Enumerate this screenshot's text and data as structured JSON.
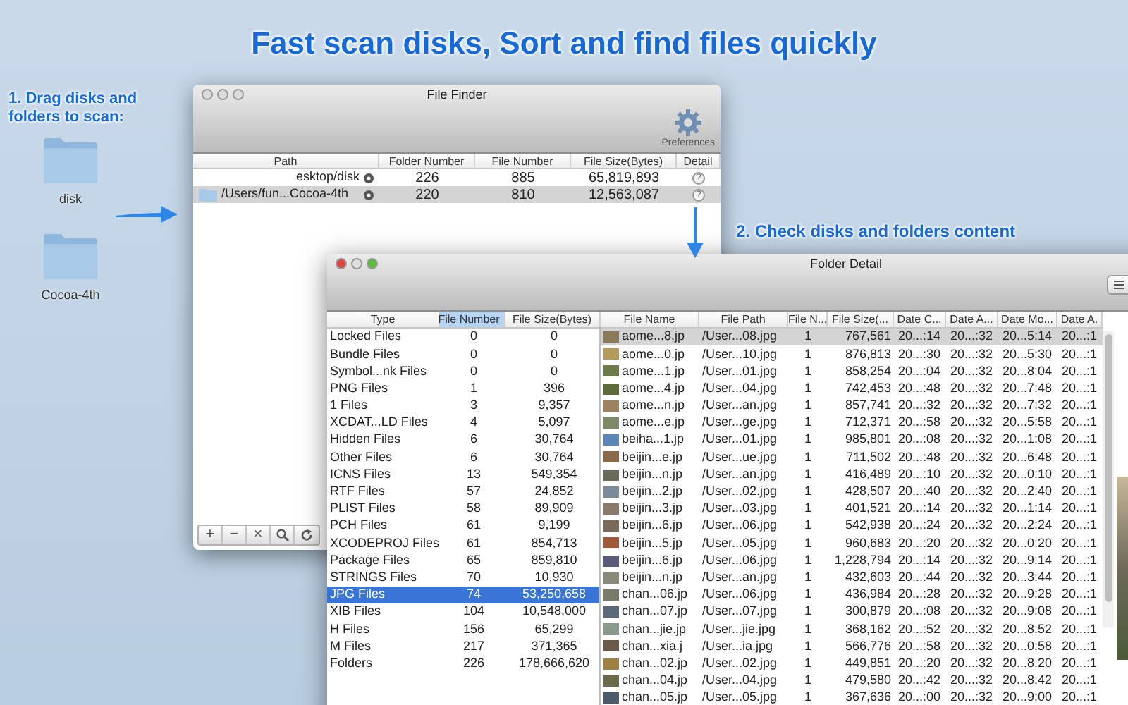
{
  "headline": "Fast scan disks, Sort and find files quickly",
  "desktop_items": [
    {
      "label": "disk"
    },
    {
      "label": "Cocoa-4th"
    }
  ],
  "annotations": [
    {
      "text": "1. Drag disks and folders to scan:"
    },
    {
      "text": "2. Check disks and folders content"
    }
  ],
  "file_finder": {
    "title": "File Finder",
    "toolbar_button": "Preferences",
    "columns": [
      "Path",
      "Folder Number",
      "File Number",
      "File Size(Bytes)",
      "Detail"
    ],
    "rows": [
      {
        "path": "esktop/disk",
        "icon": false,
        "folder_number": "226",
        "file_number": "885",
        "file_size": "65,819,893",
        "detail": "?",
        "selected": false
      },
      {
        "path": "/Users/fun...Cocoa-4th",
        "icon": true,
        "folder_number": "220",
        "file_number": "810",
        "file_size": "12,563,087",
        "detail": "?",
        "selected": true
      }
    ],
    "bottom_buttons": [
      {
        "kind": "text",
        "label": "+"
      },
      {
        "kind": "text",
        "label": "−"
      },
      {
        "kind": "text",
        "label": "×"
      },
      {
        "kind": "search"
      },
      {
        "kind": "refresh"
      }
    ]
  },
  "folder_detail": {
    "title": "Folder Detail",
    "type_table": {
      "columns": [
        {
          "label": "Type",
          "sorted": false
        },
        {
          "label": "File Number",
          "sorted": true
        },
        {
          "label": "File Size(Bytes)",
          "sorted": false
        }
      ],
      "rows": [
        {
          "cells": [
            "Locked Files",
            "0",
            "0"
          ],
          "selected": false
        },
        {
          "cells": [
            "Bundle Files",
            "0",
            "0"
          ],
          "selected": false
        },
        {
          "cells": [
            "Symbol...nk Files",
            "0",
            "0"
          ],
          "selected": false
        },
        {
          "cells": [
            "PNG Files",
            "1",
            "396"
          ],
          "selected": false
        },
        {
          "cells": [
            "1 Files",
            "3",
            "9,357"
          ],
          "selected": false
        },
        {
          "cells": [
            "XCDAT...LD Files",
            "4",
            "5,097"
          ],
          "selected": false
        },
        {
          "cells": [
            "Hidden Files",
            "6",
            "30,764"
          ],
          "selected": false
        },
        {
          "cells": [
            "Other Files",
            "6",
            "30,764"
          ],
          "selected": false
        },
        {
          "cells": [
            "ICNS Files",
            "13",
            "549,354"
          ],
          "selected": false
        },
        {
          "cells": [
            "RTF Files",
            "57",
            "24,852"
          ],
          "selected": false
        },
        {
          "cells": [
            "PLIST Files",
            "58",
            "89,909"
          ],
          "selected": false
        },
        {
          "cells": [
            "PCH Files",
            "61",
            "9,199"
          ],
          "selected": false
        },
        {
          "cells": [
            "XCODEPROJ Files",
            "61",
            "854,713"
          ],
          "selected": false
        },
        {
          "cells": [
            "Package Files",
            "65",
            "859,810"
          ],
          "selected": false
        },
        {
          "cells": [
            "STRINGS Files",
            "70",
            "10,930"
          ],
          "selected": false
        },
        {
          "cells": [
            "JPG Files",
            "74",
            "53,250,658"
          ],
          "selected": true
        },
        {
          "cells": [
            "XIB Files",
            "104",
            "10,548,000"
          ],
          "selected": false
        },
        {
          "cells": [
            "H Files",
            "156",
            "65,299"
          ],
          "selected": false
        },
        {
          "cells": [
            "M Files",
            "217",
            "371,365"
          ],
          "selected": false
        },
        {
          "cells": [
            "Folders",
            "226",
            "178,666,620"
          ],
          "selected": false
        }
      ]
    },
    "file_table": {
      "columns": [
        "File Name",
        "File Path",
        "File N...",
        "File Size(...",
        "Date C...",
        "Date A...",
        "Date Mo...",
        "Date A."
      ],
      "rows": [
        {
          "cells": [
            "aome...8.jp",
            "/User...08.jpg",
            "1",
            "767,561",
            "20...:14",
            "20...:32",
            "20...5:14",
            "20...:1"
          ],
          "selected": true
        },
        {
          "cells": [
            "aome...0.jp",
            "/User...10.jpg",
            "1",
            "876,813",
            "20...:30",
            "20...:32",
            "20...5:30",
            "20...:1"
          ],
          "selected": false
        },
        {
          "cells": [
            "aome...1.jp",
            "/User...01.jpg",
            "1",
            "858,254",
            "20...:04",
            "20...:32",
            "20...8:04",
            "20...:1"
          ],
          "selected": false
        },
        {
          "cells": [
            "aome...4.jp",
            "/User...04.jpg",
            "1",
            "742,453",
            "20...:48",
            "20...:32",
            "20...7:48",
            "20...:1"
          ],
          "selected": false
        },
        {
          "cells": [
            "aome...n.jp",
            "/User...an.jpg",
            "1",
            "857,741",
            "20...:32",
            "20...:32",
            "20...7:32",
            "20...:1"
          ],
          "selected": false
        },
        {
          "cells": [
            "aome...e.jp",
            "/User...ge.jpg",
            "1",
            "712,371",
            "20...:58",
            "20...:32",
            "20...5:58",
            "20...:1"
          ],
          "selected": false
        },
        {
          "cells": [
            "beiha...1.jp",
            "/User...01.jpg",
            "1",
            "985,801",
            "20...:08",
            "20...:32",
            "20...1:08",
            "20...:1"
          ],
          "selected": false
        },
        {
          "cells": [
            "beijin...e.jp",
            "/User...ue.jpg",
            "1",
            "711,502",
            "20...:48",
            "20...:32",
            "20...6:48",
            "20...:1"
          ],
          "selected": false
        },
        {
          "cells": [
            "beijin...n.jp",
            "/User...an.jpg",
            "1",
            "416,489",
            "20...:10",
            "20...:32",
            "20...0:10",
            "20...:1"
          ],
          "selected": false
        },
        {
          "cells": [
            "beijin...2.jp",
            "/User...02.jpg",
            "1",
            "428,507",
            "20...:40",
            "20...:32",
            "20...2:40",
            "20...:1"
          ],
          "selected": false
        },
        {
          "cells": [
            "beijin...3.jp",
            "/User...03.jpg",
            "1",
            "401,521",
            "20...:14",
            "20...:32",
            "20...1:14",
            "20...:1"
          ],
          "selected": false
        },
        {
          "cells": [
            "beijin...6.jp",
            "/User...06.jpg",
            "1",
            "542,938",
            "20...:24",
            "20...:32",
            "20...2:24",
            "20...:1"
          ],
          "selected": false
        },
        {
          "cells": [
            "beijin...5.jp",
            "/User...05.jpg",
            "1",
            "960,683",
            "20...:20",
            "20...:32",
            "20...0:20",
            "20...:1"
          ],
          "selected": false
        },
        {
          "cells": [
            "beijin...6.jp",
            "/User...06.jpg",
            "1",
            "1,228,794",
            "20...:14",
            "20...:32",
            "20...9:14",
            "20...:1"
          ],
          "selected": false
        },
        {
          "cells": [
            "beijin...n.jp",
            "/User...an.jpg",
            "1",
            "432,603",
            "20...:44",
            "20...:32",
            "20...3:44",
            "20...:1"
          ],
          "selected": false
        },
        {
          "cells": [
            "chan...06.jp",
            "/User...06.jpg",
            "1",
            "436,984",
            "20...:28",
            "20...:32",
            "20...9:28",
            "20...:1"
          ],
          "selected": false
        },
        {
          "cells": [
            "chan...07.jp",
            "/User...07.jpg",
            "1",
            "300,879",
            "20...:08",
            "20...:32",
            "20...9:08",
            "20...:1"
          ],
          "selected": false
        },
        {
          "cells": [
            "chan...jie.jp",
            "/User...jie.jpg",
            "1",
            "368,162",
            "20...:52",
            "20...:32",
            "20...8:52",
            "20...:1"
          ],
          "selected": false
        },
        {
          "cells": [
            "chan...xia.j",
            "/User...ia.jpg",
            "1",
            "566,776",
            "20...:58",
            "20...:32",
            "20...0:58",
            "20...:1"
          ],
          "selected": false
        },
        {
          "cells": [
            "chan...02.jp",
            "/User...02.jpg",
            "1",
            "449,851",
            "20...:20",
            "20...:32",
            "20...8:20",
            "20...:1"
          ],
          "selected": false
        },
        {
          "cells": [
            "chan...04.jp",
            "/User...04.jpg",
            "1",
            "479,580",
            "20...:42",
            "20...:32",
            "20...8:42",
            "20...:1"
          ],
          "selected": false
        },
        {
          "cells": [
            "chan...05.jp",
            "/User...05.jpg",
            "1",
            "367,636",
            "20...:00",
            "20...:32",
            "20...9:00",
            "20...:1"
          ],
          "selected": false
        }
      ]
    }
  }
}
